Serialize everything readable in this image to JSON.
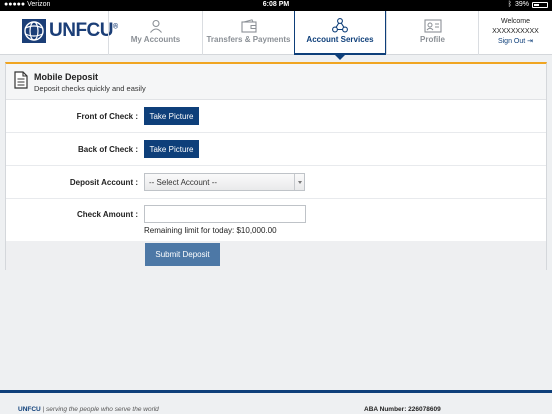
{
  "status_bar": {
    "carrier": "●●●●● Verizon",
    "time": "6:08 PM",
    "battery": "39%",
    "battery_level": 0.39
  },
  "header": {
    "logo_text": "UNFCU",
    "logo_mark": "®",
    "nav": [
      {
        "label": "My Accounts",
        "icon": "person-icon",
        "active": false
      },
      {
        "label": "Transfers & Payments",
        "icon": "wallet-icon",
        "active": false
      },
      {
        "label": "Account Services",
        "icon": "network-icon",
        "active": true
      },
      {
        "label": "Profile",
        "icon": "id-card-icon",
        "active": false
      }
    ],
    "welcome": "Welcome",
    "username": "XXXXXXXXXX",
    "sign_out": "Sign Out"
  },
  "panel": {
    "title": "Mobile Deposit",
    "subtitle": "Deposit checks quickly and easily",
    "front_label": "Front of Check :",
    "front_button": "Take Picture",
    "back_label": "Back of Check :",
    "back_button": "Take Picture",
    "account_label": "Deposit Account :",
    "account_selected": "-- Select Account --",
    "amount_label": "Check Amount :",
    "amount_value": "",
    "remaining_limit": "Remaining limit for today: $10,000.00",
    "submit": "Submit Deposit"
  },
  "footer": {
    "brand": "UNFCU",
    "tagline": "| serving the people who serve the world",
    "aba": "ABA Number: 226078609"
  },
  "colors": {
    "navy": "#0e3f7a",
    "accent_orange": "#f0a522",
    "submit_blue": "#4d78a6"
  }
}
